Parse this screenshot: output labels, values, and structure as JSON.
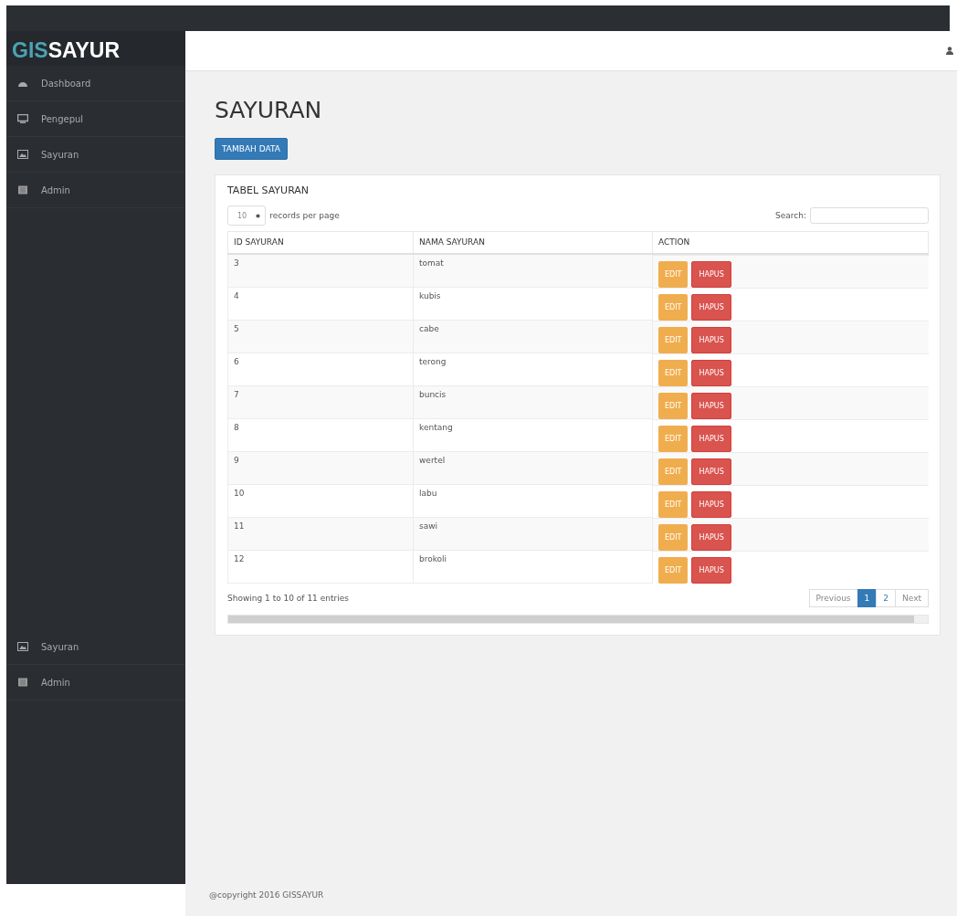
{
  "brand": {
    "part_1": "GIS",
    "part_2": "SAYUR"
  },
  "sidebar": {
    "items": [
      {
        "label": "Dashboard",
        "kind": "dashboard"
      },
      {
        "label": "Pengepul",
        "kind": "monitor"
      },
      {
        "label": "Sayuran",
        "kind": "picture"
      },
      {
        "label": "Admin",
        "kind": "list"
      }
    ],
    "items_lower": [
      {
        "label": "Sayuran",
        "kind": "picture"
      },
      {
        "label": "Admin",
        "kind": "list"
      }
    ]
  },
  "page_title": "SAYURAN",
  "add_button": "TAMBAH DATA",
  "table_card": {
    "title": "TABEL SAYURAN",
    "page_size": "10",
    "page_size_label": "records per page",
    "search_label": "Search:",
    "columns": [
      "ID SAYURAN",
      "NAMA SAYURAN",
      "ACTION"
    ],
    "rows": [
      {
        "id": "3",
        "name": "tomat",
        "edit": "EDIT",
        "delete": "HAPUS"
      },
      {
        "id": "4",
        "name": "kubis",
        "edit": "EDIT",
        "delete": "HAPUS"
      },
      {
        "id": "5",
        "name": "cabe",
        "edit": "EDIT",
        "delete": "HAPUS"
      },
      {
        "id": "6",
        "name": "terong",
        "edit": "EDIT",
        "delete": "HAPUS"
      },
      {
        "id": "7",
        "name": "buncis",
        "edit": "EDIT",
        "delete": "HAPUS"
      },
      {
        "id": "8",
        "name": "kentang",
        "edit": "EDIT",
        "delete": "HAPUS"
      },
      {
        "id": "9",
        "name": "wertel",
        "edit": "EDIT",
        "delete": "HAPUS"
      },
      {
        "id": "10",
        "name": "labu",
        "edit": "EDIT",
        "delete": "HAPUS"
      },
      {
        "id": "11",
        "name": "sawi",
        "edit": "EDIT",
        "delete": "HAPUS"
      },
      {
        "id": "12",
        "name": "brokoli",
        "edit": "EDIT",
        "delete": "HAPUS"
      }
    ],
    "info": "Showing 1 to 10 of 11 entries",
    "pagination": [
      {
        "label": "Previous",
        "kind": "nav",
        "selected": false
      },
      {
        "label": "1",
        "kind": "page",
        "selected": true
      },
      {
        "label": "2",
        "kind": "page",
        "selected": false
      },
      {
        "label": "Next",
        "kind": "nav",
        "selected": false
      }
    ]
  },
  "footer": "@copyright 2016 GISSAYUR"
}
